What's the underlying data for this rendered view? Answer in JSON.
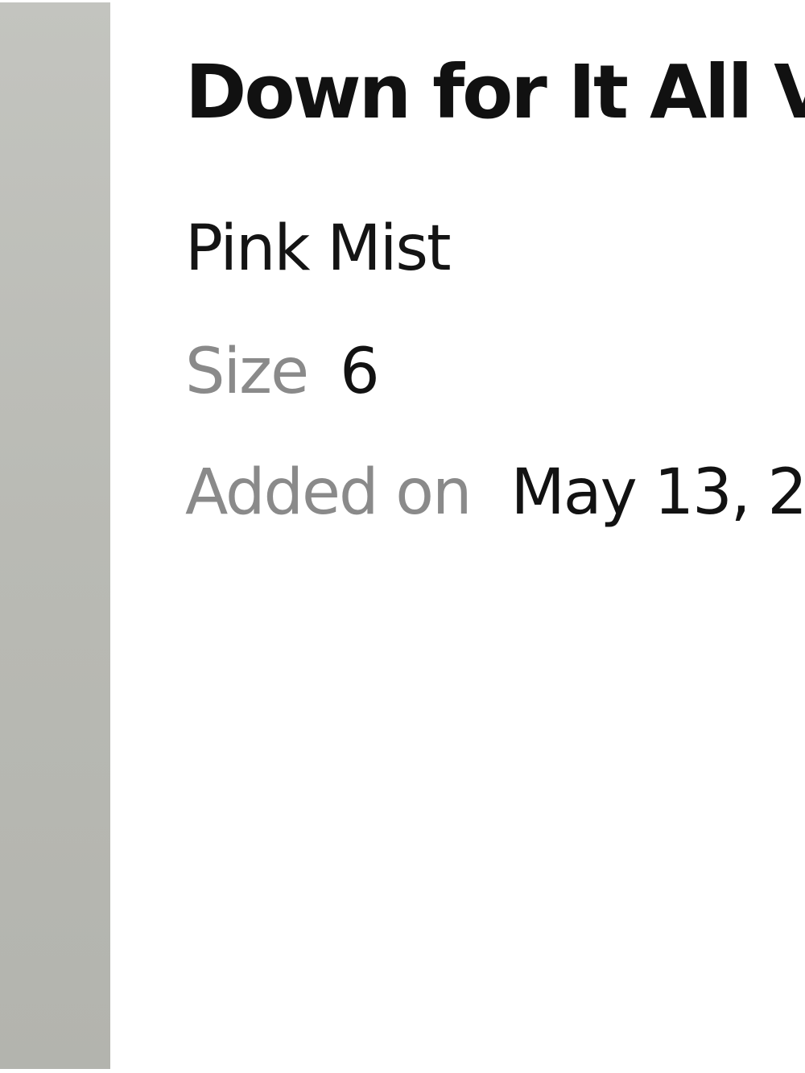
{
  "product": {
    "name": "Down for It All V",
    "color": "Pink Mist",
    "size_label": "Size",
    "size_value": "6",
    "added_label": "Added on",
    "added_value": "May 13, 2"
  },
  "colors": {
    "image_placeholder": "#bcbdb7",
    "label_gray": "#8a8a8a",
    "text_dark": "#121212"
  }
}
